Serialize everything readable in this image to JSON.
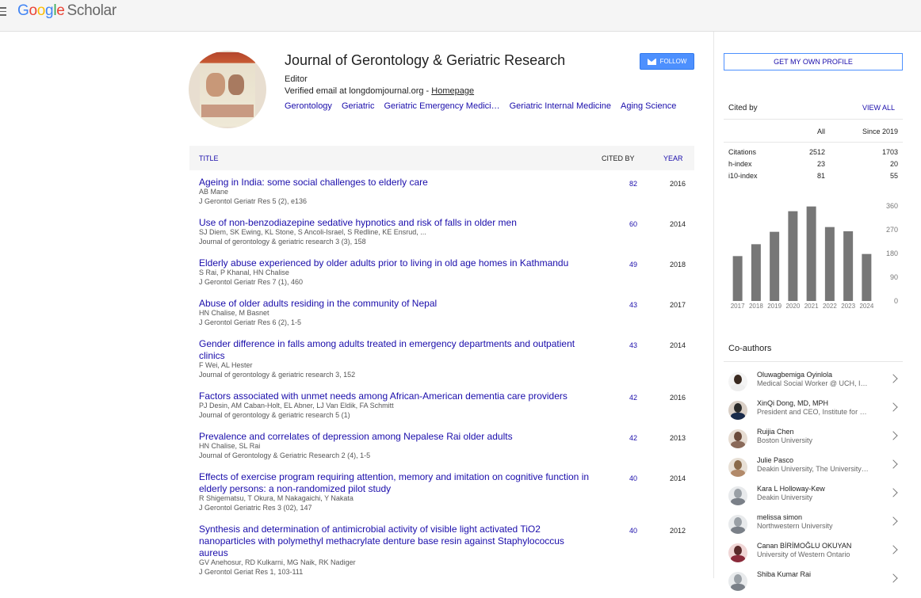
{
  "header": {
    "logo_google": "Google",
    "logo_scholar": "Scholar"
  },
  "profile": {
    "name": "Journal of Gerontology & Geriatric Research",
    "affiliation": "Editor",
    "email_text": "Verified email at longdomjournal.org - ",
    "homepage_label": "Homepage",
    "interests": [
      "Gerontology",
      "Geriatric",
      "Geriatric Emergency Medici…",
      "Geriatric Internal Medicine",
      "Aging Science"
    ],
    "follow_label": "FOLLOW"
  },
  "table": {
    "col_title": "TITLE",
    "col_cited": "CITED BY",
    "col_year": "YEAR",
    "rows": [
      {
        "title": "Ageing in India: some social challenges to elderly care",
        "authors": "AB Mane",
        "venue": "J Gerontol Geriatr Res 5 (2), e136",
        "cited": "82",
        "year": "2016"
      },
      {
        "title": "Use of non-benzodiazepine sedative hypnotics and risk of falls in older men",
        "authors": "SJ Diem, SK Ewing, KL Stone, S Ancoli-Israel, S Redline, KE Ensrud, ...",
        "venue": "Journal of gerontology & geriatric research 3 (3), 158",
        "cited": "60",
        "year": "2014"
      },
      {
        "title": "Elderly abuse experienced by older adults prior to living in old age homes in Kathmandu",
        "authors": "S Rai, P Khanal, HN Chalise",
        "venue": "J Gerontol Geriatr Res 7 (1), 460",
        "cited": "49",
        "year": "2018"
      },
      {
        "title": "Abuse of older adults residing in the community of Nepal",
        "authors": "HN Chalise, M Basnet",
        "venue": "J Gerontol Geriatr Res 6 (2), 1-5",
        "cited": "43",
        "year": "2017"
      },
      {
        "title": "Gender difference in falls among adults treated in emergency departments and outpatient clinics",
        "authors": "F Wei, AL Hester",
        "venue": "Journal of gerontology & geriatric research 3, 152",
        "cited": "43",
        "year": "2014"
      },
      {
        "title": "Factors associated with unmet needs among African-American dementia care providers",
        "authors": "PJ Desin, AM Caban-Holt, EL Abner, LJ Van Eldik, FA Schmitt",
        "venue": "Journal of gerontology & geriatric research 5 (1)",
        "cited": "42",
        "year": "2016"
      },
      {
        "title": "Prevalence and correlates of depression among Nepalese Rai older adults",
        "authors": "HN Chalise, SL Rai",
        "venue": "Journal of Gerontology & Geriatric Research 2 (4), 1-5",
        "cited": "42",
        "year": "2013"
      },
      {
        "title": "Effects of exercise program requiring attention, memory and imitation on cognitive function in elderly persons: a non-randomized pilot study",
        "authors": "R Shigematsu, T Okura, M Nakagaichi, Y Nakata",
        "venue": "J Gerontol Geriatric Res 3 (02), 147",
        "cited": "40",
        "year": "2014"
      },
      {
        "title": "Synthesis and determination of antimicrobial activity of visible light activated TiO2 nanoparticles with polymethyl methacrylate denture base resin against Staphylococcus aureus",
        "authors": "GV Anehosur, RD Kulkarni, MG Naik, RK Nadiger",
        "venue": "J Gerontol Geriat Res 1, 103-111",
        "cited": "40",
        "year": "2012"
      }
    ]
  },
  "sidebar": {
    "get_profile_label": "GET MY OWN PROFILE",
    "cited_by_label": "Cited by",
    "view_all_label": "VIEW ALL",
    "col_all": "All",
    "col_since": "Since 2019",
    "metrics": [
      {
        "label": "Citations",
        "all": "2512",
        "since": "1703"
      },
      {
        "label": "h-index",
        "all": "23",
        "since": "20"
      },
      {
        "label": "i10-index",
        "all": "81",
        "since": "55"
      }
    ],
    "coauthors_label": "Co-authors",
    "coauthors": [
      {
        "name": "Oluwagbemiga Oyinlola",
        "affiliation": "Medical Social Worker @ UCH, I…"
      },
      {
        "name": "XinQi Dong, MD, MPH",
        "affiliation": "President and CEO, Institute for …"
      },
      {
        "name": "Ruijia Chen",
        "affiliation": "Boston University"
      },
      {
        "name": "Julie Pasco",
        "affiliation": "Deakin University, The University…"
      },
      {
        "name": "Kara L Holloway-Kew",
        "affiliation": "Deakin University"
      },
      {
        "name": "melissa simon",
        "affiliation": "Northwestern University"
      },
      {
        "name": "Canan BİRİMOĞLU OKUYAN",
        "affiliation": "University of Western Ontario"
      },
      {
        "name": "Shiba Kumar Rai",
        "affiliation": ""
      }
    ]
  },
  "chart_data": {
    "type": "bar",
    "categories": [
      "2017",
      "2018",
      "2019",
      "2020",
      "2021",
      "2022",
      "2023",
      "2024"
    ],
    "values": [
      170,
      215,
      262,
      340,
      358,
      280,
      264,
      178
    ],
    "ylim": [
      0,
      360
    ],
    "yticks": [
      "0",
      "90",
      "180",
      "270",
      "360"
    ],
    "bar_color": "#777777"
  }
}
